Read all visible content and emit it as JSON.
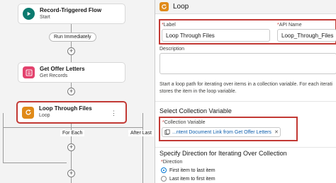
{
  "canvas": {
    "start_node": {
      "title": "Record-Triggered Flow",
      "subtitle": "Start"
    },
    "run_pill": "Run Immediately",
    "get_node": {
      "title": "Get Offer Letters",
      "subtitle": "Get Records"
    },
    "loop_node": {
      "title": "Loop Through Files",
      "subtitle": "Loop"
    },
    "branch_for_each": "For Each",
    "branch_after_last": "After Last",
    "plus_symbol": "+",
    "kebab_symbol": "⋮"
  },
  "panel": {
    "header_title": "Loop",
    "label_field": {
      "label": "Label",
      "value": "Loop Through Files"
    },
    "api_field": {
      "label": "API Name",
      "value": "Loop_Through_Files"
    },
    "description_label": "Description",
    "help_line1": "Start a loop path for iterating over items in a collection variable. For each iterati",
    "help_line2": "stores the item in the loop variable.",
    "select_collection_title": "Select Collection Variable",
    "collection_label": "Collection Variable",
    "collection_value": "...ntent Document Link from Get Offer Letters",
    "direction_title": "Specify Direction for Iterating Over Collection",
    "direction_label": "Direction",
    "options": [
      "First item to last item",
      "Last item to first item"
    ],
    "required_mark": "*",
    "remove_symbol": "✕"
  },
  "colors": {
    "start_icon": "#0b7a6f",
    "get_icon": "#e3426d",
    "loop_icon": "#e08a19",
    "highlight": "#c23934",
    "link": "#0b5cab"
  }
}
